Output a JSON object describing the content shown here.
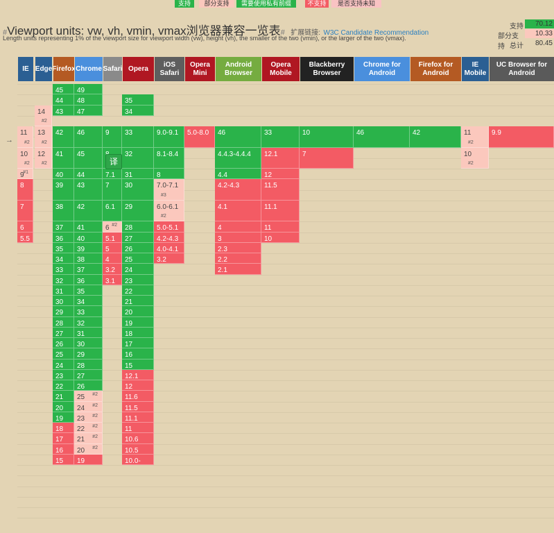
{
  "legend": [
    {
      "label": "支持",
      "bg": "#2ab34a",
      "fg": "#fff"
    },
    {
      "label": "部分支持",
      "bg": "#fbc8bd",
      "fg": "#333"
    },
    {
      "label": "需要使用私有前缀",
      "bg": "#2ab34a",
      "fg": "#fff"
    },
    {
      "label": "不支持",
      "bg": "#f35b64",
      "fg": "#fff"
    },
    {
      "label": "是否支持未知",
      "bg": "#f9c3c3",
      "fg": "#333"
    }
  ],
  "header": {
    "title_hash": "#",
    "title": "Viewport units: vw, vh, vmin, vmax浏览器兼容一览表",
    "title_hash_end": "#",
    "ext_label": "扩展链接:",
    "spec_link": "W3C Candidate Recommendation",
    "subtitle": "Length units representing 1% of the viewport size for viewport width (vw), height (vh), the smaller of the two (vmin), or the larger of the two (vmax)."
  },
  "summary": [
    {
      "label": "支持",
      "value": "70.12",
      "bg": "#2ab34a"
    },
    {
      "label": "部分支持",
      "value": "10.33",
      "bg": "#fbc8bd"
    },
    {
      "label": "总计",
      "value": "80.45",
      "bg": "#e3d4b4"
    }
  ],
  "browsers": [
    {
      "name": "IE",
      "color": "#2b5f93"
    },
    {
      "name": "Edge",
      "color": "#2b5f93"
    },
    {
      "name": "Firefox",
      "color": "#b45a23"
    },
    {
      "name": "Chrome",
      "color": "#4a8fdd"
    },
    {
      "name": "Safari",
      "color": "#8a8a8a"
    },
    {
      "name": "Opera",
      "color": "#b01722"
    },
    {
      "name": "iOS\nSafari",
      "color": "#5e5e5e"
    },
    {
      "name": "Opera\nMini",
      "color": "#b01722"
    },
    {
      "name": "Android\nBrowser",
      "color": "#75ac40"
    },
    {
      "name": "Opera\nMobile",
      "color": "#b01722"
    },
    {
      "name": "Blackberry\nBrowser",
      "color": "#222222"
    },
    {
      "name": "Chrome for\nAndroid",
      "color": "#4a8fdd"
    },
    {
      "name": "Firefox for\nAndroid",
      "color": "#b45a23"
    },
    {
      "name": "IE\nMobile",
      "color": "#2b5f93"
    },
    {
      "name": "UC Browser for\nAndroid",
      "color": "#5a5a5a"
    }
  ],
  "current_arrow": "→",
  "translate_badge": "译",
  "cells": [
    {
      "col": 2,
      "row": 0,
      "text": "45",
      "s": "y"
    },
    {
      "col": 3,
      "row": 0,
      "text": "49",
      "s": "y"
    },
    {
      "col": 2,
      "row": 1,
      "text": "44",
      "s": "y"
    },
    {
      "col": 3,
      "row": 1,
      "text": "48",
      "s": "y"
    },
    {
      "col": 5,
      "row": 1,
      "text": "35",
      "s": "y"
    },
    {
      "col": 1,
      "row": 2,
      "span": 2,
      "text": "14",
      "note": "#2",
      "s": "a"
    },
    {
      "col": 2,
      "row": 2,
      "text": "43",
      "s": "y"
    },
    {
      "col": 3,
      "row": 2,
      "text": "47",
      "s": "y"
    },
    {
      "col": 5,
      "row": 2,
      "text": "34",
      "s": "y"
    },
    {
      "col": 0,
      "row": 4,
      "span": 2,
      "text": "11",
      "note": "#2",
      "s": "a"
    },
    {
      "col": 1,
      "row": 4,
      "span": 2,
      "text": "13",
      "note": "#2",
      "s": "a"
    },
    {
      "col": 2,
      "row": 4,
      "span": 2,
      "text": "42",
      "s": "y"
    },
    {
      "col": 3,
      "row": 4,
      "span": 2,
      "text": "46",
      "s": "y"
    },
    {
      "col": 4,
      "row": 4,
      "span": 2,
      "text": "9",
      "s": "y"
    },
    {
      "col": 5,
      "row": 4,
      "span": 2,
      "text": "33",
      "s": "y"
    },
    {
      "col": 6,
      "row": 4,
      "span": 2,
      "text": "9.0-9.1",
      "s": "y"
    },
    {
      "col": 7,
      "row": 4,
      "span": 2,
      "text": "5.0-8.0",
      "s": "n"
    },
    {
      "col": 8,
      "row": 4,
      "span": 2,
      "text": "46",
      "s": "y"
    },
    {
      "col": 9,
      "row": 4,
      "span": 2,
      "text": "33",
      "s": "y"
    },
    {
      "col": 10,
      "row": 4,
      "span": 2,
      "text": "10",
      "s": "y"
    },
    {
      "col": 11,
      "row": 4,
      "span": 2,
      "text": "46",
      "s": "y"
    },
    {
      "col": 12,
      "row": 4,
      "span": 2,
      "text": "42",
      "s": "y"
    },
    {
      "col": 13,
      "row": 4,
      "span": 2,
      "text": "11",
      "note": "#2",
      "s": "a"
    },
    {
      "col": 14,
      "row": 4,
      "span": 2,
      "text": "9.9",
      "s": "n"
    },
    {
      "col": 0,
      "row": 6,
      "span": 2,
      "text": "10",
      "note": "#2",
      "s": "a"
    },
    {
      "col": 1,
      "row": 6,
      "span": 2,
      "text": "12",
      "note": "#2",
      "s": "a"
    },
    {
      "col": 2,
      "row": 6,
      "span": 2,
      "text": "41",
      "s": "y"
    },
    {
      "col": 3,
      "row": 6,
      "span": 2,
      "text": "45",
      "s": "y"
    },
    {
      "col": 4,
      "row": 6,
      "span": 2,
      "text": "8",
      "s": "y"
    },
    {
      "col": 5,
      "row": 6,
      "span": 2,
      "text": "32",
      "s": "y"
    },
    {
      "col": 6,
      "row": 6,
      "span": 2,
      "text": "8.1-8.4",
      "s": "y"
    },
    {
      "col": 8,
      "row": 6,
      "span": 2,
      "text": "4.4.3-4.4.4",
      "s": "y"
    },
    {
      "col": 9,
      "row": 6,
      "span": 2,
      "text": "12.1",
      "s": "n"
    },
    {
      "col": 10,
      "row": 6,
      "span": 2,
      "text": "7",
      "s": "n"
    },
    {
      "col": 13,
      "row": 6,
      "span": 2,
      "text": "10",
      "note": "#2",
      "s": "a"
    },
    {
      "col": 0,
      "row": 8,
      "text": "9",
      "note": "#1",
      "s": "a"
    },
    {
      "col": 2,
      "row": 8,
      "text": "40",
      "s": "y"
    },
    {
      "col": 3,
      "row": 8,
      "text": "44",
      "s": "y"
    },
    {
      "col": 4,
      "row": 8,
      "text": "7.1",
      "s": "y"
    },
    {
      "col": 5,
      "row": 8,
      "text": "31",
      "s": "y"
    },
    {
      "col": 6,
      "row": 8,
      "text": "8",
      "s": "y"
    },
    {
      "col": 8,
      "row": 8,
      "text": "4.4",
      "s": "y"
    },
    {
      "col": 9,
      "row": 8,
      "text": "12",
      "s": "n"
    },
    {
      "col": 0,
      "row": 9,
      "span": 2,
      "text": "8",
      "s": "n"
    },
    {
      "col": 2,
      "row": 9,
      "span": 2,
      "text": "39",
      "s": "y"
    },
    {
      "col": 3,
      "row": 9,
      "span": 2,
      "text": "43",
      "s": "y"
    },
    {
      "col": 4,
      "row": 9,
      "span": 2,
      "text": "7",
      "s": "y"
    },
    {
      "col": 5,
      "row": 9,
      "span": 2,
      "text": "30",
      "s": "y"
    },
    {
      "col": 6,
      "row": 9,
      "span": 2,
      "text": "7.0-7.1",
      "note": "#3",
      "s": "a"
    },
    {
      "col": 8,
      "row": 9,
      "span": 2,
      "text": "4.2-4.3",
      "s": "n"
    },
    {
      "col": 9,
      "row": 9,
      "span": 2,
      "text": "11.5",
      "s": "n"
    },
    {
      "col": 0,
      "row": 11,
      "span": 2,
      "text": "7",
      "s": "n"
    },
    {
      "col": 2,
      "row": 11,
      "span": 2,
      "text": "38",
      "s": "y"
    },
    {
      "col": 3,
      "row": 11,
      "span": 2,
      "text": "42",
      "s": "y"
    },
    {
      "col": 4,
      "row": 11,
      "span": 2,
      "text": "6.1",
      "s": "y"
    },
    {
      "col": 5,
      "row": 11,
      "span": 2,
      "text": "29",
      "s": "y"
    },
    {
      "col": 6,
      "row": 11,
      "span": 2,
      "text": "6.0-6.1",
      "note": "#2",
      "s": "a"
    },
    {
      "col": 8,
      "row": 11,
      "span": 2,
      "text": "4.1",
      "s": "n"
    },
    {
      "col": 9,
      "row": 11,
      "span": 2,
      "text": "11.1",
      "s": "n"
    },
    {
      "col": 0,
      "row": 13,
      "text": "6",
      "s": "n"
    },
    {
      "col": 2,
      "row": 13,
      "text": "37",
      "s": "y"
    },
    {
      "col": 3,
      "row": 13,
      "text": "41",
      "s": "y"
    },
    {
      "col": 4,
      "row": 13,
      "text": "6",
      "note": "#2",
      "s": "a"
    },
    {
      "col": 5,
      "row": 13,
      "text": "28",
      "s": "y"
    },
    {
      "col": 6,
      "row": 13,
      "text": "5.0-5.1",
      "s": "n"
    },
    {
      "col": 8,
      "row": 13,
      "text": "4",
      "s": "n"
    },
    {
      "col": 9,
      "row": 13,
      "text": "11",
      "s": "n"
    },
    {
      "col": 0,
      "row": 14,
      "text": "5.5",
      "s": "n"
    },
    {
      "col": 2,
      "row": 14,
      "text": "36",
      "s": "y"
    },
    {
      "col": 3,
      "row": 14,
      "text": "40",
      "s": "y"
    },
    {
      "col": 4,
      "row": 14,
      "text": "5.1",
      "s": "n"
    },
    {
      "col": 5,
      "row": 14,
      "text": "27",
      "s": "y"
    },
    {
      "col": 6,
      "row": 14,
      "text": "4.2-4.3",
      "s": "n"
    },
    {
      "col": 8,
      "row": 14,
      "text": "3",
      "s": "n"
    },
    {
      "col": 9,
      "row": 14,
      "text": "10",
      "s": "n"
    },
    {
      "col": 2,
      "row": 15,
      "text": "35",
      "s": "y"
    },
    {
      "col": 3,
      "row": 15,
      "text": "39",
      "s": "y"
    },
    {
      "col": 4,
      "row": 15,
      "text": "5",
      "s": "n"
    },
    {
      "col": 5,
      "row": 15,
      "text": "26",
      "s": "y"
    },
    {
      "col": 6,
      "row": 15,
      "text": "4.0-4.1",
      "s": "n"
    },
    {
      "col": 8,
      "row": 15,
      "text": "2.3",
      "s": "n"
    },
    {
      "col": 2,
      "row": 16,
      "text": "34",
      "s": "y"
    },
    {
      "col": 3,
      "row": 16,
      "text": "38",
      "s": "y"
    },
    {
      "col": 4,
      "row": 16,
      "text": "4",
      "s": "n"
    },
    {
      "col": 5,
      "row": 16,
      "text": "25",
      "s": "y"
    },
    {
      "col": 6,
      "row": 16,
      "text": "3.2",
      "s": "n"
    },
    {
      "col": 8,
      "row": 16,
      "text": "2.2",
      "s": "n"
    },
    {
      "col": 2,
      "row": 17,
      "text": "33",
      "s": "y"
    },
    {
      "col": 3,
      "row": 17,
      "text": "37",
      "s": "y"
    },
    {
      "col": 4,
      "row": 17,
      "text": "3.2",
      "s": "n"
    },
    {
      "col": 5,
      "row": 17,
      "text": "24",
      "s": "y"
    },
    {
      "col": 8,
      "row": 17,
      "text": "2.1",
      "s": "n"
    },
    {
      "col": 2,
      "row": 18,
      "text": "32",
      "s": "y"
    },
    {
      "col": 3,
      "row": 18,
      "text": "36",
      "s": "y"
    },
    {
      "col": 4,
      "row": 18,
      "text": "3.1",
      "s": "n"
    },
    {
      "col": 5,
      "row": 18,
      "text": "23",
      "s": "y"
    },
    {
      "col": 2,
      "row": 19,
      "text": "31",
      "s": "y"
    },
    {
      "col": 3,
      "row": 19,
      "text": "35",
      "s": "y"
    },
    {
      "col": 5,
      "row": 19,
      "text": "22",
      "s": "y"
    },
    {
      "col": 2,
      "row": 20,
      "text": "30",
      "s": "y"
    },
    {
      "col": 3,
      "row": 20,
      "text": "34",
      "s": "y"
    },
    {
      "col": 5,
      "row": 20,
      "text": "21",
      "s": "y"
    },
    {
      "col": 2,
      "row": 21,
      "text": "29",
      "s": "y"
    },
    {
      "col": 3,
      "row": 21,
      "text": "33",
      "s": "y"
    },
    {
      "col": 5,
      "row": 21,
      "text": "20",
      "s": "y"
    },
    {
      "col": 2,
      "row": 22,
      "text": "28",
      "s": "y"
    },
    {
      "col": 3,
      "row": 22,
      "text": "32",
      "s": "y"
    },
    {
      "col": 5,
      "row": 22,
      "text": "19",
      "s": "y"
    },
    {
      "col": 2,
      "row": 23,
      "text": "27",
      "s": "y"
    },
    {
      "col": 3,
      "row": 23,
      "text": "31",
      "s": "y"
    },
    {
      "col": 5,
      "row": 23,
      "text": "18",
      "s": "y"
    },
    {
      "col": 2,
      "row": 24,
      "text": "26",
      "s": "y"
    },
    {
      "col": 3,
      "row": 24,
      "text": "30",
      "s": "y"
    },
    {
      "col": 5,
      "row": 24,
      "text": "17",
      "s": "y"
    },
    {
      "col": 2,
      "row": 25,
      "text": "25",
      "s": "y"
    },
    {
      "col": 3,
      "row": 25,
      "text": "29",
      "s": "y"
    },
    {
      "col": 5,
      "row": 25,
      "text": "16",
      "s": "y"
    },
    {
      "col": 2,
      "row": 26,
      "text": "24",
      "s": "y"
    },
    {
      "col": 3,
      "row": 26,
      "text": "28",
      "s": "y"
    },
    {
      "col": 5,
      "row": 26,
      "text": "15",
      "s": "y"
    },
    {
      "col": 2,
      "row": 27,
      "text": "23",
      "s": "y"
    },
    {
      "col": 3,
      "row": 27,
      "text": "27",
      "s": "y"
    },
    {
      "col": 5,
      "row": 27,
      "text": "12.1",
      "s": "n"
    },
    {
      "col": 2,
      "row": 28,
      "text": "22",
      "s": "y"
    },
    {
      "col": 3,
      "row": 28,
      "text": "26",
      "s": "y"
    },
    {
      "col": 5,
      "row": 28,
      "text": "12",
      "s": "n"
    },
    {
      "col": 2,
      "row": 29,
      "text": "21",
      "s": "y"
    },
    {
      "col": 3,
      "row": 29,
      "text": "25",
      "note": "#2",
      "s": "a"
    },
    {
      "col": 5,
      "row": 29,
      "text": "11.6",
      "s": "n"
    },
    {
      "col": 2,
      "row": 30,
      "text": "20",
      "s": "y"
    },
    {
      "col": 3,
      "row": 30,
      "text": "24",
      "note": "#2",
      "s": "a"
    },
    {
      "col": 5,
      "row": 30,
      "text": "11.5",
      "s": "n"
    },
    {
      "col": 2,
      "row": 31,
      "text": "19",
      "s": "y"
    },
    {
      "col": 3,
      "row": 31,
      "text": "23",
      "note": "#2",
      "s": "a"
    },
    {
      "col": 5,
      "row": 31,
      "text": "11.1",
      "s": "n"
    },
    {
      "col": 2,
      "row": 32,
      "text": "18",
      "s": "n"
    },
    {
      "col": 3,
      "row": 32,
      "text": "22",
      "note": "#2",
      "s": "a"
    },
    {
      "col": 5,
      "row": 32,
      "text": "11",
      "s": "n"
    },
    {
      "col": 2,
      "row": 33,
      "text": "17",
      "s": "n"
    },
    {
      "col": 3,
      "row": 33,
      "text": "21",
      "note": "#2",
      "s": "a"
    },
    {
      "col": 5,
      "row": 33,
      "text": "10.6",
      "s": "n"
    },
    {
      "col": 2,
      "row": 34,
      "text": "16",
      "s": "n"
    },
    {
      "col": 3,
      "row": 34,
      "text": "20",
      "note": "#2",
      "s": "a"
    },
    {
      "col": 5,
      "row": 34,
      "text": "10.5",
      "s": "n"
    },
    {
      "col": 2,
      "row": 35,
      "text": "15",
      "s": "n"
    },
    {
      "col": 3,
      "row": 35,
      "text": "19",
      "s": "n"
    },
    {
      "col": 5,
      "row": 35,
      "text": "10.0-",
      "s": "n"
    }
  ]
}
